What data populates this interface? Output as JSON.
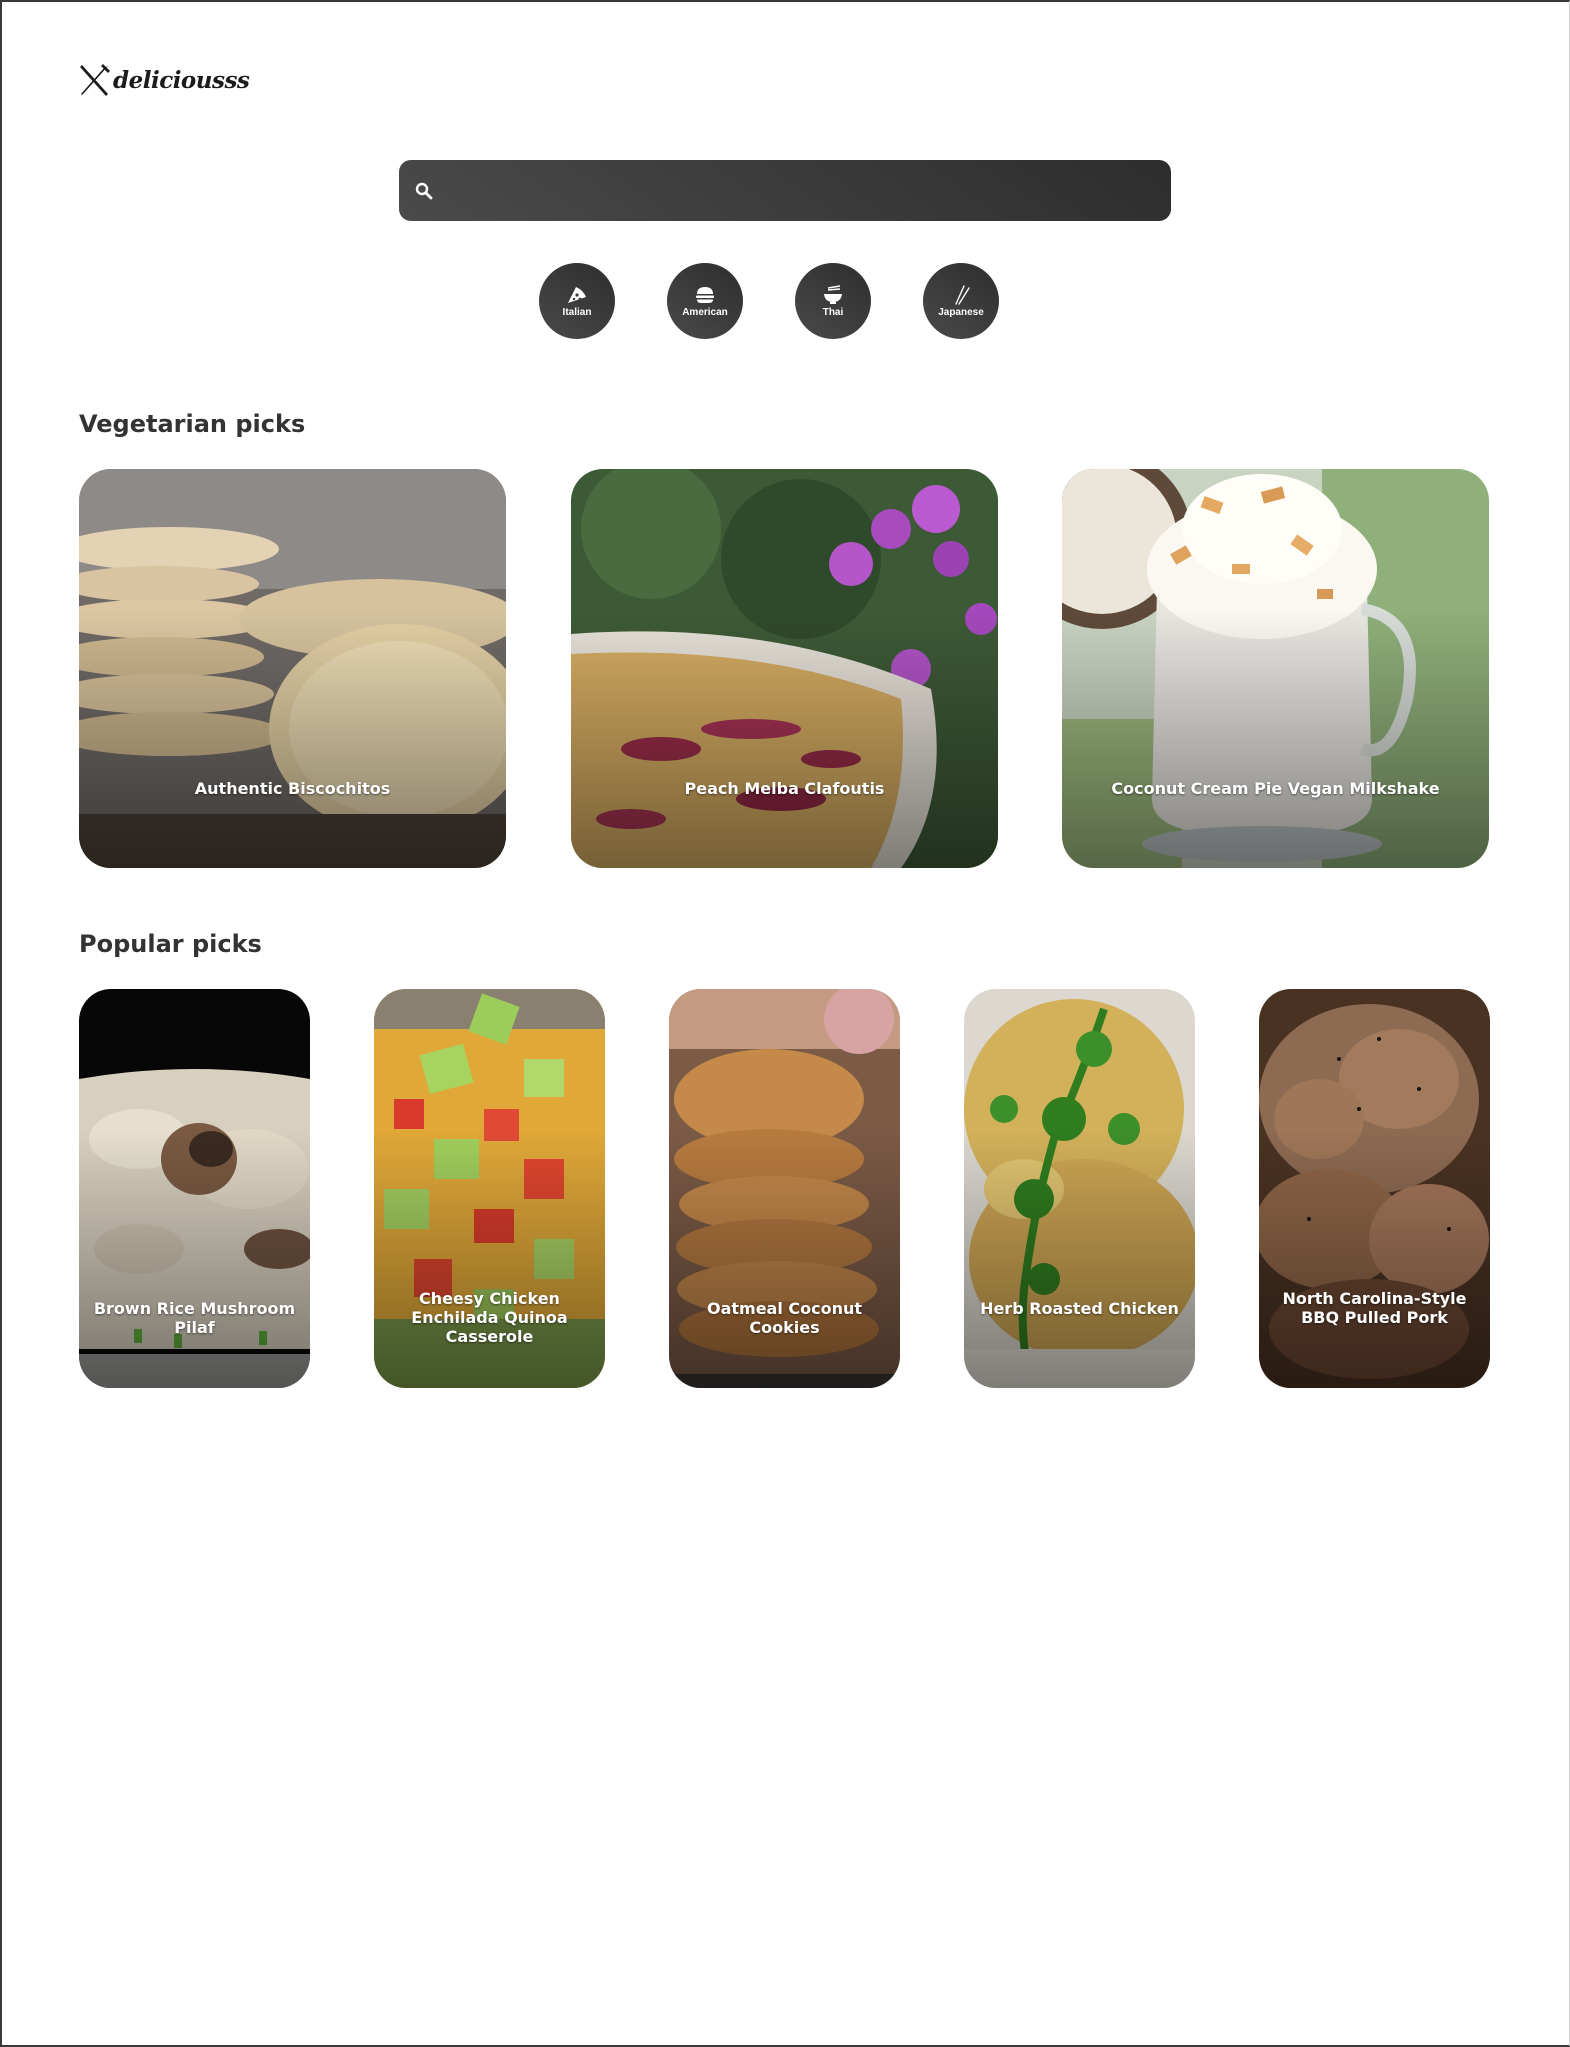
{
  "brand": {
    "name": "deliciousss",
    "icon": "fork-knife-icon"
  },
  "search": {
    "placeholder": "",
    "value": "",
    "icon": "search-icon"
  },
  "cuisines": [
    {
      "label": "Italian",
      "icon": "pizza-icon"
    },
    {
      "label": "American",
      "icon": "burger-icon"
    },
    {
      "label": "Thai",
      "icon": "noodle-bowl-icon"
    },
    {
      "label": "Japanese",
      "icon": "chopsticks-icon"
    }
  ],
  "vegetarian": {
    "title": "Vegetarian picks",
    "items": [
      {
        "name": "Authentic Biscochitos"
      },
      {
        "name": "Peach Melba Clafoutis"
      },
      {
        "name": "Coconut Cream Pie Vegan Milkshake"
      }
    ]
  },
  "popular": {
    "title": "Popular picks",
    "items": [
      {
        "name": "Brown Rice Mushroom Pilaf"
      },
      {
        "name": "Cheesy Chicken Enchilada Quinoa Casserole"
      },
      {
        "name": "Oatmeal Coconut Cookies"
      },
      {
        "name": "Herb Roasted Chicken"
      },
      {
        "name": "North Carolina-Style BBQ Pulled Pork"
      }
    ]
  },
  "colors": {
    "accent": "#3a3a3a",
    "background": "#ffffff",
    "text": "#333333"
  }
}
